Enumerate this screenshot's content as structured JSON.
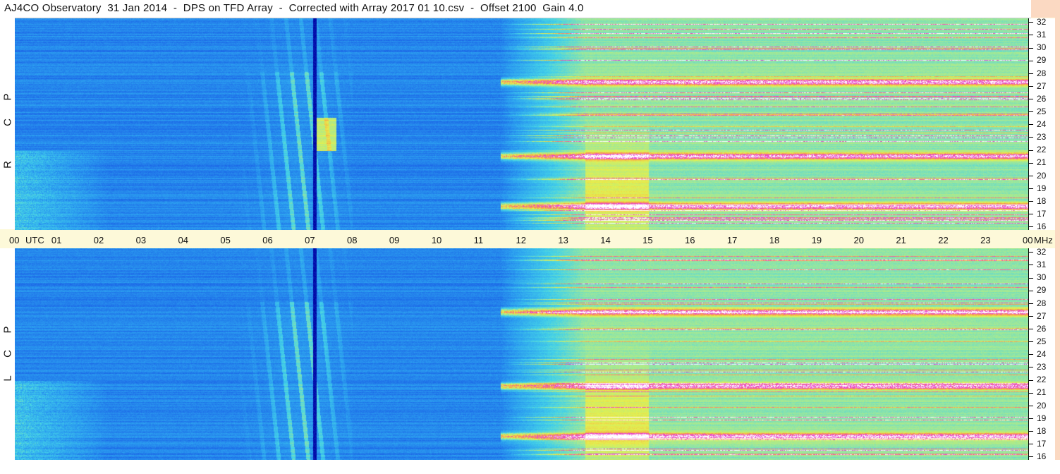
{
  "title": "AJ4CO Observatory  31 Jan 2014  -  DPS on TFD Array  -  Corrected with Array 2017 01 10.csv  -  Offset 2100  Gain 4.0",
  "colors": {
    "accent": "#fdf9d9",
    "margin": "#fbd9c2"
  },
  "chart_data": {
    "type": "heatmap",
    "time_unit_label": "UTC",
    "freq_unit_label": "MHz",
    "x_ticks": [
      "00",
      "01",
      "02",
      "03",
      "04",
      "05",
      "06",
      "07",
      "08",
      "09",
      "10",
      "11",
      "12",
      "13",
      "14",
      "15",
      "16",
      "17",
      "18",
      "19",
      "20",
      "21",
      "22",
      "23",
      "00"
    ],
    "y_ticks": [
      "32",
      "31",
      "30",
      "29",
      "28",
      "27",
      "26",
      "25",
      "24",
      "23",
      "22",
      "21",
      "20",
      "19",
      "18",
      "17",
      "16"
    ],
    "xlim_utc_hours": [
      0,
      24
    ],
    "ylim_mhz": [
      16,
      32
    ],
    "panels": [
      {
        "label": "R C P",
        "polarization": "RCP"
      },
      {
        "label": "L C P",
        "polarization": "LCP"
      }
    ],
    "colormap": [
      "#0000a0",
      "#1a5ee6",
      "#2ca0f0",
      "#44d2e8",
      "#9ee89a",
      "#e6f04c",
      "#f7a04a",
      "#e83ad0",
      "#ffffff"
    ],
    "features": {
      "jupiter_burst_utc": [
        5.3,
        8.0
      ],
      "dark_spike_utc": 7.1,
      "solar_activity_onset_utc": 11.5,
      "strong_rfi_bands_mhz": [
        17.8,
        21.6,
        27.2
      ]
    }
  }
}
